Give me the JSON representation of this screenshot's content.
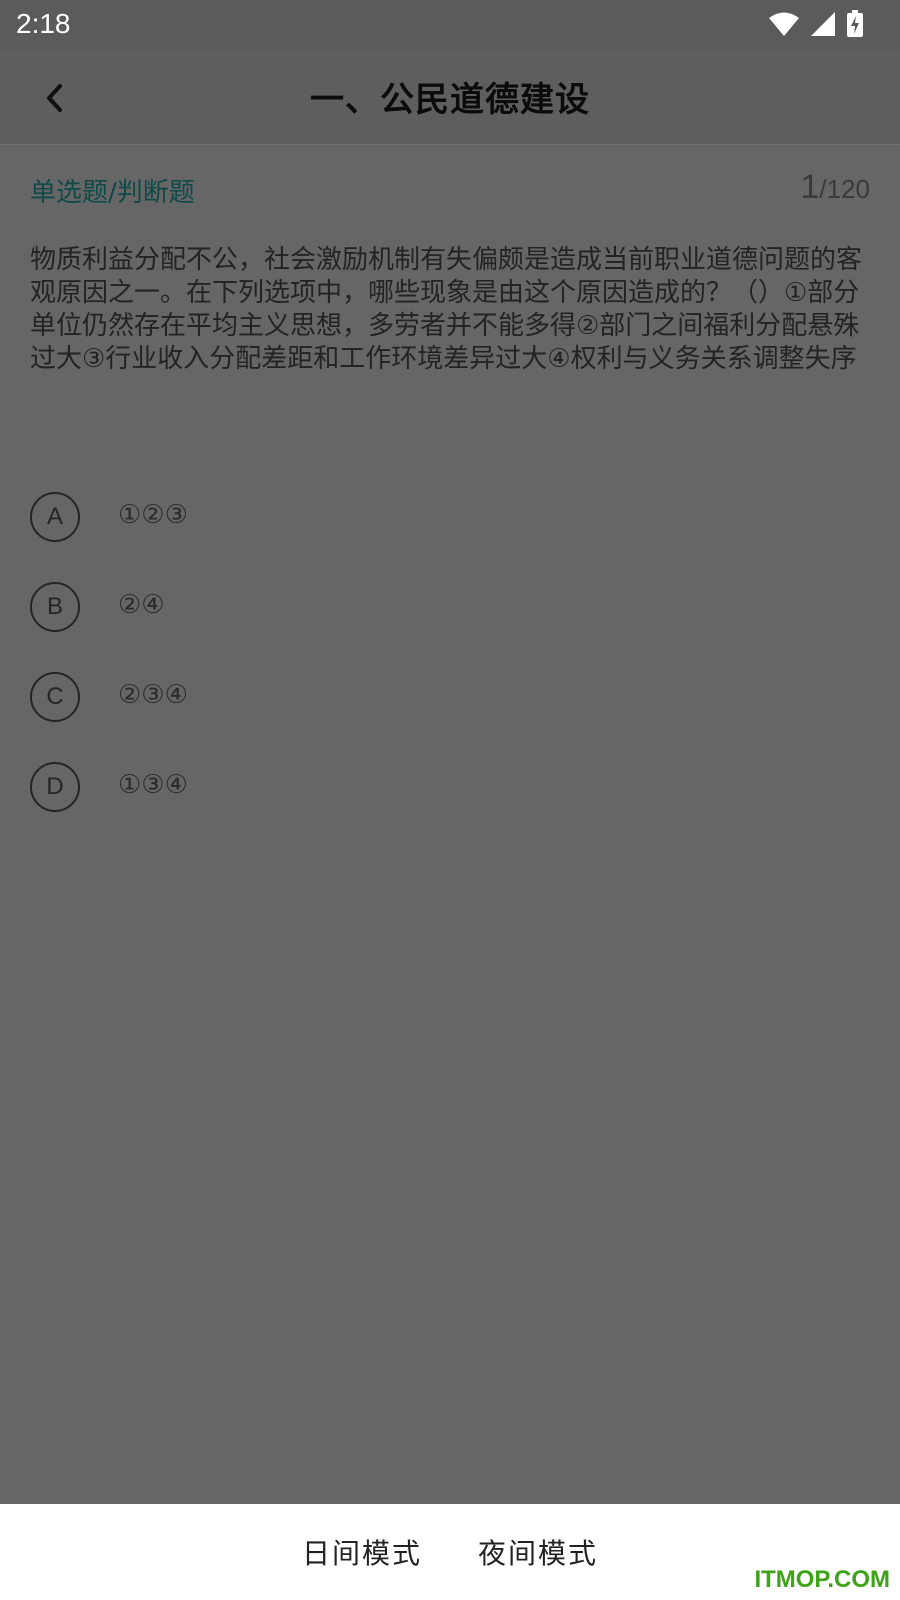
{
  "status": {
    "time": "2:18"
  },
  "header": {
    "title": "一、公民道德建设"
  },
  "meta": {
    "question_type": "单选题/判断题",
    "current": "1",
    "total": "/120"
  },
  "question": {
    "text": "物质利益分配不公，社会激励机制有失偏颇是造成当前职业道德问题的客观原因之一。在下列选项中，哪些现象是由这个原因造成的？（）①部分单位仍然存在平均主义思想，多劳者并不能多得②部门之间福利分配悬殊过大③行业收入分配差距和工作环境差异过大④权利与义务关系调整失序"
  },
  "options": [
    {
      "letter": "A",
      "text": "①②③"
    },
    {
      "letter": "B",
      "text": "②④"
    },
    {
      "letter": "C",
      "text": "②③④"
    },
    {
      "letter": "D",
      "text": "①③④"
    }
  ],
  "bottom_sheet": {
    "day_mode": "日间模式",
    "night_mode": "夜间模式"
  },
  "watermark": "ITMOP.COM",
  "colors": {
    "overlay": "#666666",
    "question_type": "#0f4948",
    "watermark": "#3ea318"
  },
  "icons": {
    "back": "chevron-left-icon",
    "wifi": "wifi-icon",
    "signal": "signal-icon",
    "battery": "battery-charging-icon"
  }
}
